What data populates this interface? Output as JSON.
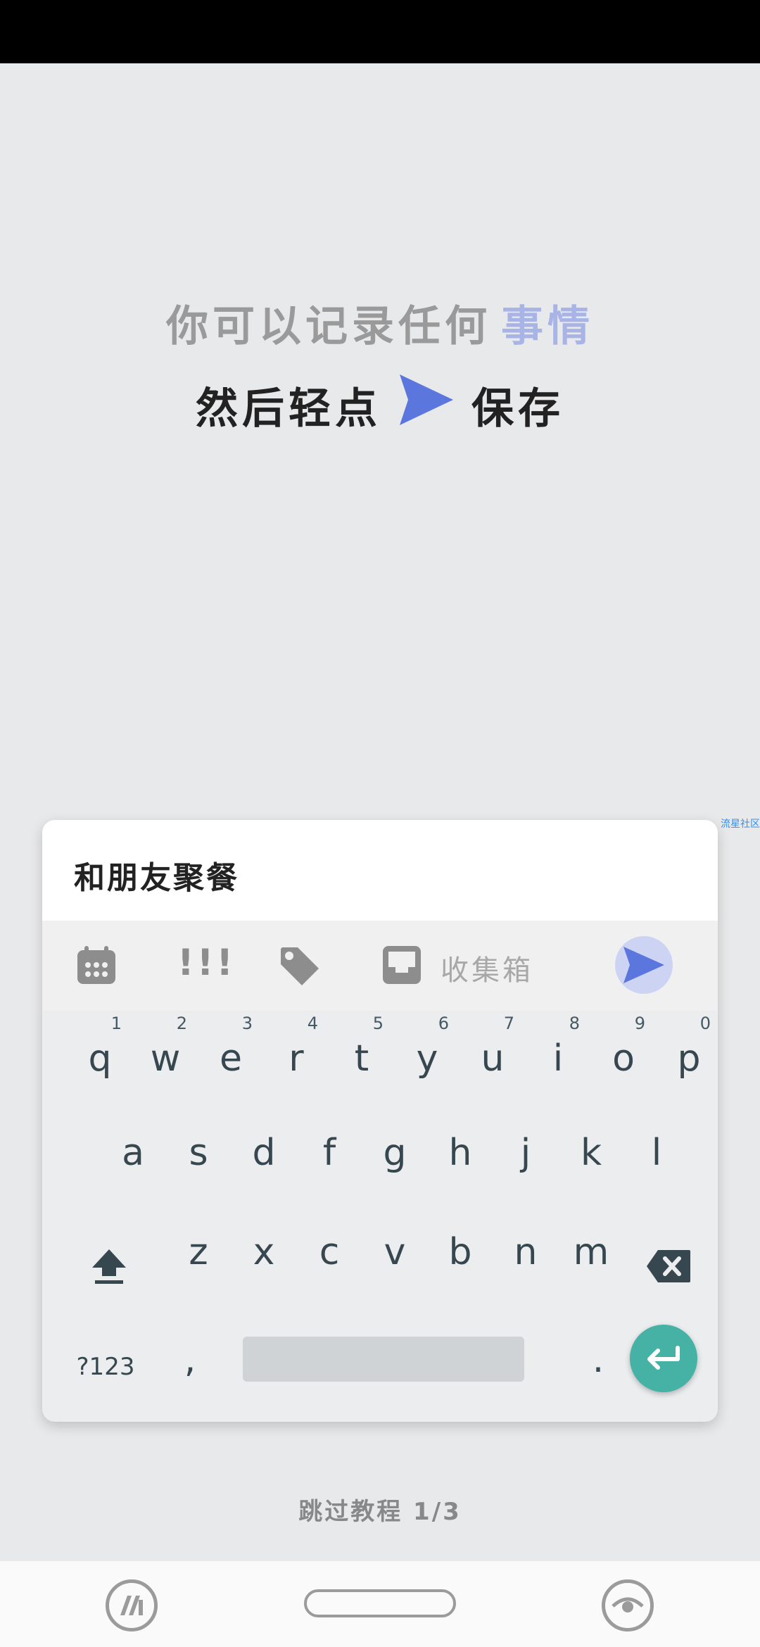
{
  "tutorial": {
    "line1": "你可以记录任何",
    "line1_accent": "事情",
    "line2_before": "然后轻点",
    "line2_after": "保存"
  },
  "watermark": "流星社区",
  "note": {
    "text": "和朋友聚餐",
    "inbox_label": "收集箱",
    "priority_label": "!!!"
  },
  "keyboard": {
    "row1": [
      {
        "k": "q",
        "hint": "1"
      },
      {
        "k": "w",
        "hint": "2"
      },
      {
        "k": "e",
        "hint": "3"
      },
      {
        "k": "r",
        "hint": "4"
      },
      {
        "k": "t",
        "hint": "5"
      },
      {
        "k": "y",
        "hint": "6"
      },
      {
        "k": "u",
        "hint": "7"
      },
      {
        "k": "i",
        "hint": "8"
      },
      {
        "k": "o",
        "hint": "9"
      },
      {
        "k": "p",
        "hint": "0"
      }
    ],
    "row2": [
      "a",
      "s",
      "d",
      "f",
      "g",
      "h",
      "j",
      "k",
      "l"
    ],
    "row3": [
      "z",
      "x",
      "c",
      "v",
      "b",
      "n",
      "m"
    ],
    "symbols_label": "?123",
    "comma": ",",
    "period": "."
  },
  "footer": {
    "skip_label": "跳过教程 1/3"
  },
  "colors": {
    "accent": "#5b77de",
    "accent_light": "#a9b4e6",
    "enter_key": "#46b2a6"
  },
  "icons": {
    "toolbar": [
      "calendar-icon",
      "priority-icon",
      "tag-icon",
      "inbox-icon",
      "send-icon"
    ],
    "nav": [
      "app-icon",
      "home-pill",
      "eye-icon"
    ]
  }
}
